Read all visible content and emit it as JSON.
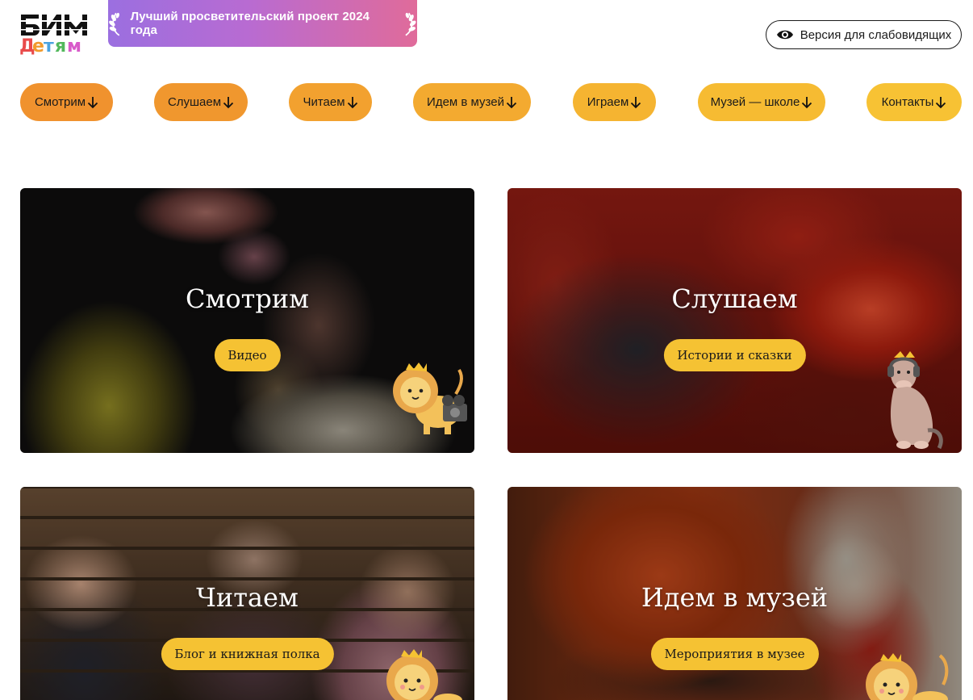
{
  "header": {
    "logo_alt": "БИМ Детям",
    "award_text": "Лучший просветительский проект 2024 года",
    "accessibility_label": "Версия для слабовидящих"
  },
  "nav": {
    "items": [
      {
        "label": "Смотрим",
        "color": "#f0922e"
      },
      {
        "label": "Слушаем",
        "color": "#f0972e"
      },
      {
        "label": "Читаем",
        "color": "#f2a12f"
      },
      {
        "label": "Идем в музей",
        "color": "#f3aa30"
      },
      {
        "label": "Играем",
        "color": "#f5b431"
      },
      {
        "label": "Музей — школе",
        "color": "#f6bb32"
      },
      {
        "label": "Контакты",
        "color": "#f7c234"
      }
    ]
  },
  "cards": [
    {
      "title": "Смотрим",
      "button": "Видео",
      "mascot": "lion-with-film-camera-icon"
    },
    {
      "title": "Слушаем",
      "button": "Истории и сказки",
      "mascot": "donkey-with-headphones-icon"
    },
    {
      "title": "Читаем",
      "button": "Блог и книжная полка",
      "mascot": "lion-icon"
    },
    {
      "title": "Идем в музей",
      "button": "Мероприятия в музее",
      "mascot": "lion-icon"
    }
  ],
  "colors": {
    "accent_yellow": "#f5c233",
    "accent_orange": "#f0922e",
    "award_gradient_start": "#9b6fe0",
    "award_gradient_end": "#e06b9a"
  }
}
